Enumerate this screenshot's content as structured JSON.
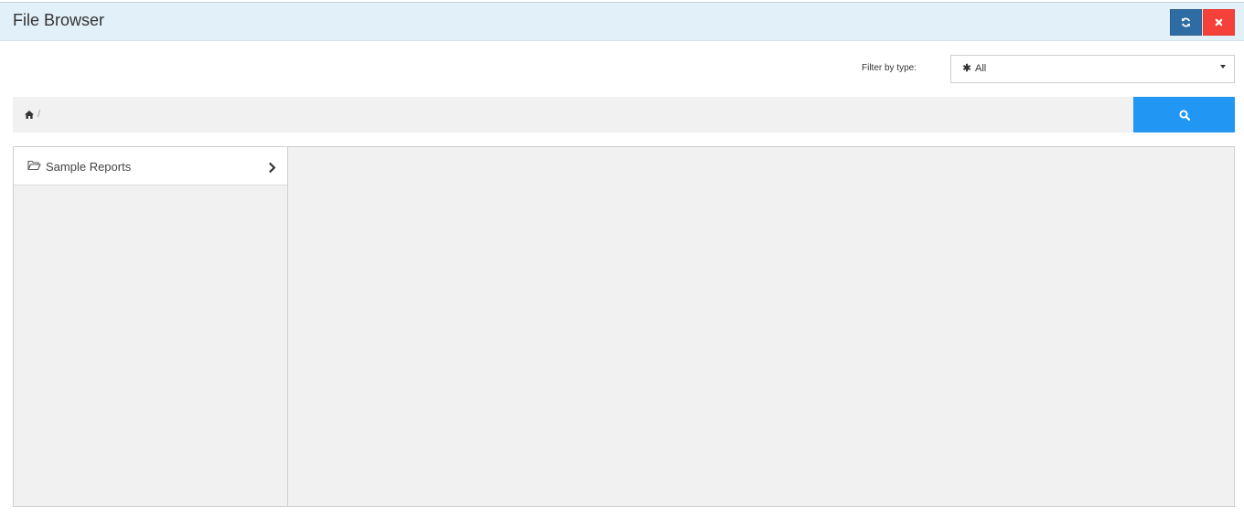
{
  "window": {
    "title": "File Browser",
    "buttons": {
      "refresh_icon": "refresh-icon",
      "close_icon": "close-icon",
      "refresh_color": "#2e6da4",
      "close_color": "#f5413a"
    }
  },
  "filter": {
    "label": "Filter by type:",
    "selected": "All",
    "selected_icon": "asterisk-icon"
  },
  "breadcrumb": {
    "home_icon": "home-icon",
    "separator": "/"
  },
  "search": {
    "icon": "search-icon",
    "color": "#2196f3"
  },
  "tree": {
    "items": [
      {
        "label": "Sample Reports",
        "icon": "folder-open-icon",
        "expand_icon": "chevron-right-icon"
      }
    ]
  }
}
